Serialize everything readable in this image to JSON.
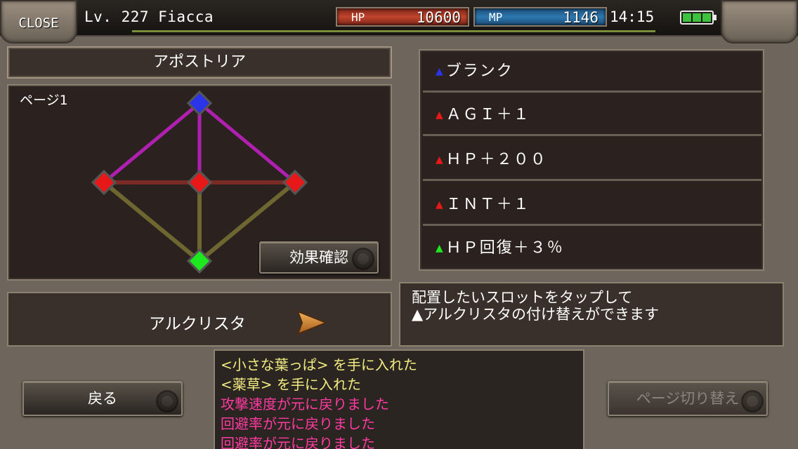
{
  "header": {
    "close_label": "CLOSE",
    "level": "Lv. 227 Fiacca",
    "hp_label": "HP",
    "hp_value": "10600",
    "mp_label": "MP",
    "mp_value": "1146",
    "clock": "14:15",
    "battery_level": 1.0
  },
  "apostoria": {
    "title": "アポストリア",
    "page_label": "ページ1",
    "effect_button": "効果確認",
    "nodes": [
      {
        "slot": "top",
        "color": "#2a34e8"
      },
      {
        "slot": "left",
        "color": "#e81818"
      },
      {
        "slot": "center",
        "color": "#e81818"
      },
      {
        "slot": "right",
        "color": "#e81818"
      },
      {
        "slot": "bottom",
        "color": "#1ee81e"
      }
    ]
  },
  "slots": [
    {
      "marker_color": "#2a34e8",
      "label": "ブランク"
    },
    {
      "marker_color": "#e81818",
      "label": "ＡＧＩ＋１"
    },
    {
      "marker_color": "#e81818",
      "label": "ＨＰ＋２００"
    },
    {
      "marker_color": "#e81818",
      "label": "ＩＮＴ＋１"
    },
    {
      "marker_color": "#1ee81e",
      "label": "ＨＰ回復＋３％"
    }
  ],
  "arcrista": {
    "label": "アルクリスタ"
  },
  "info": {
    "line1": "配置したいスロットをタップして",
    "line2": "▲アルクリスタの付け替えができます"
  },
  "buttons": {
    "back": "戻る",
    "page_switch": "ページ切り替え"
  },
  "log": [
    {
      "text": "<小さな葉っぱ> を手に入れた",
      "color": "yellow"
    },
    {
      "text": "<薬草> を手に入れた",
      "color": "yellow"
    },
    {
      "text": "攻撃速度が元に戻りました",
      "color": "pink"
    },
    {
      "text": "回避率が元に戻りました",
      "color": "pink"
    },
    {
      "text": "回避率が元に戻りました",
      "color": "pink"
    }
  ]
}
